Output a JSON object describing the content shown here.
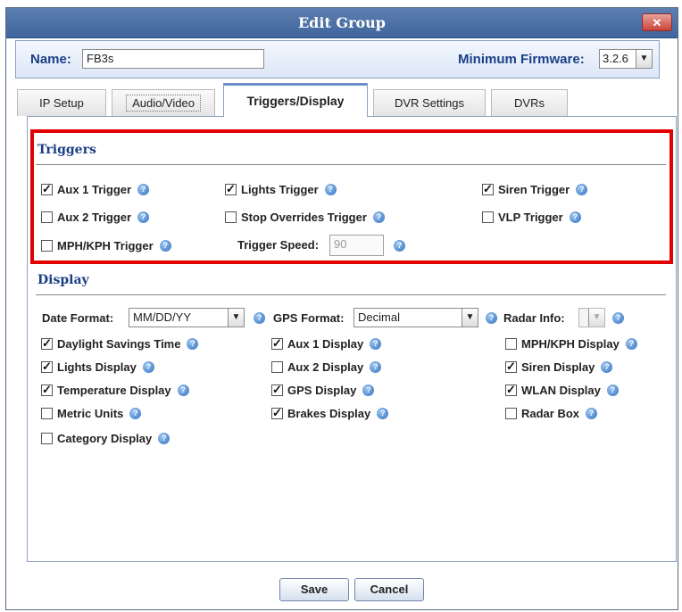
{
  "dialog": {
    "title": "Edit Group",
    "close_glyph": "✕"
  },
  "header": {
    "name_label": "Name:",
    "name_value": "FB3s",
    "firmware_label": "Minimum Firmware:",
    "firmware_value": "3.2.6"
  },
  "tabs": [
    {
      "label": "IP Setup",
      "active": false
    },
    {
      "label": "Audio/Video",
      "active": false
    },
    {
      "label": "Triggers/Display",
      "active": true
    },
    {
      "label": "DVR Settings",
      "active": false
    },
    {
      "label": "DVRs",
      "active": false
    }
  ],
  "triggers": {
    "title": "Triggers",
    "items": [
      {
        "label": "Aux 1 Trigger",
        "checked": true
      },
      {
        "label": "Lights Trigger",
        "checked": true
      },
      {
        "label": "Siren Trigger",
        "checked": true
      },
      {
        "label": "Aux 2 Trigger",
        "checked": false
      },
      {
        "label": "Stop Overrides Trigger",
        "checked": false
      },
      {
        "label": "VLP Trigger",
        "checked": false
      },
      {
        "label": "MPH/KPH Trigger",
        "checked": false
      }
    ],
    "speed_label": "Trigger Speed:",
    "speed_value": "90"
  },
  "display": {
    "title": "Display",
    "date_format_label": "Date Format:",
    "date_format_value": "MM/DD/YY",
    "gps_format_label": "GPS Format:",
    "gps_format_value": "Decimal",
    "radar_info_label": "Radar Info:",
    "radar_info_value": "",
    "items": [
      {
        "label": "Daylight Savings Time",
        "checked": true
      },
      {
        "label": "Aux 1 Display",
        "checked": true
      },
      {
        "label": "MPH/KPH Display",
        "checked": false
      },
      {
        "label": "Lights Display",
        "checked": true
      },
      {
        "label": "Aux 2 Display",
        "checked": false
      },
      {
        "label": "Siren Display",
        "checked": true
      },
      {
        "label": "Temperature Display",
        "checked": true
      },
      {
        "label": "GPS Display",
        "checked": true
      },
      {
        "label": "WLAN Display",
        "checked": true
      },
      {
        "label": "Metric Units",
        "checked": false
      },
      {
        "label": "Brakes Display",
        "checked": true
      },
      {
        "label": "Radar Box",
        "checked": false
      },
      {
        "label": "Category Display",
        "checked": false
      }
    ]
  },
  "footer": {
    "save_label": "Save",
    "cancel_label": "Cancel"
  },
  "colors": {
    "title_bar": "#4a6fa5",
    "highlight": "#e30000",
    "section_title": "#1b3f86"
  },
  "icons": {
    "help": "help-icon",
    "close": "close-icon",
    "dropdown": "chevron-down-icon"
  }
}
